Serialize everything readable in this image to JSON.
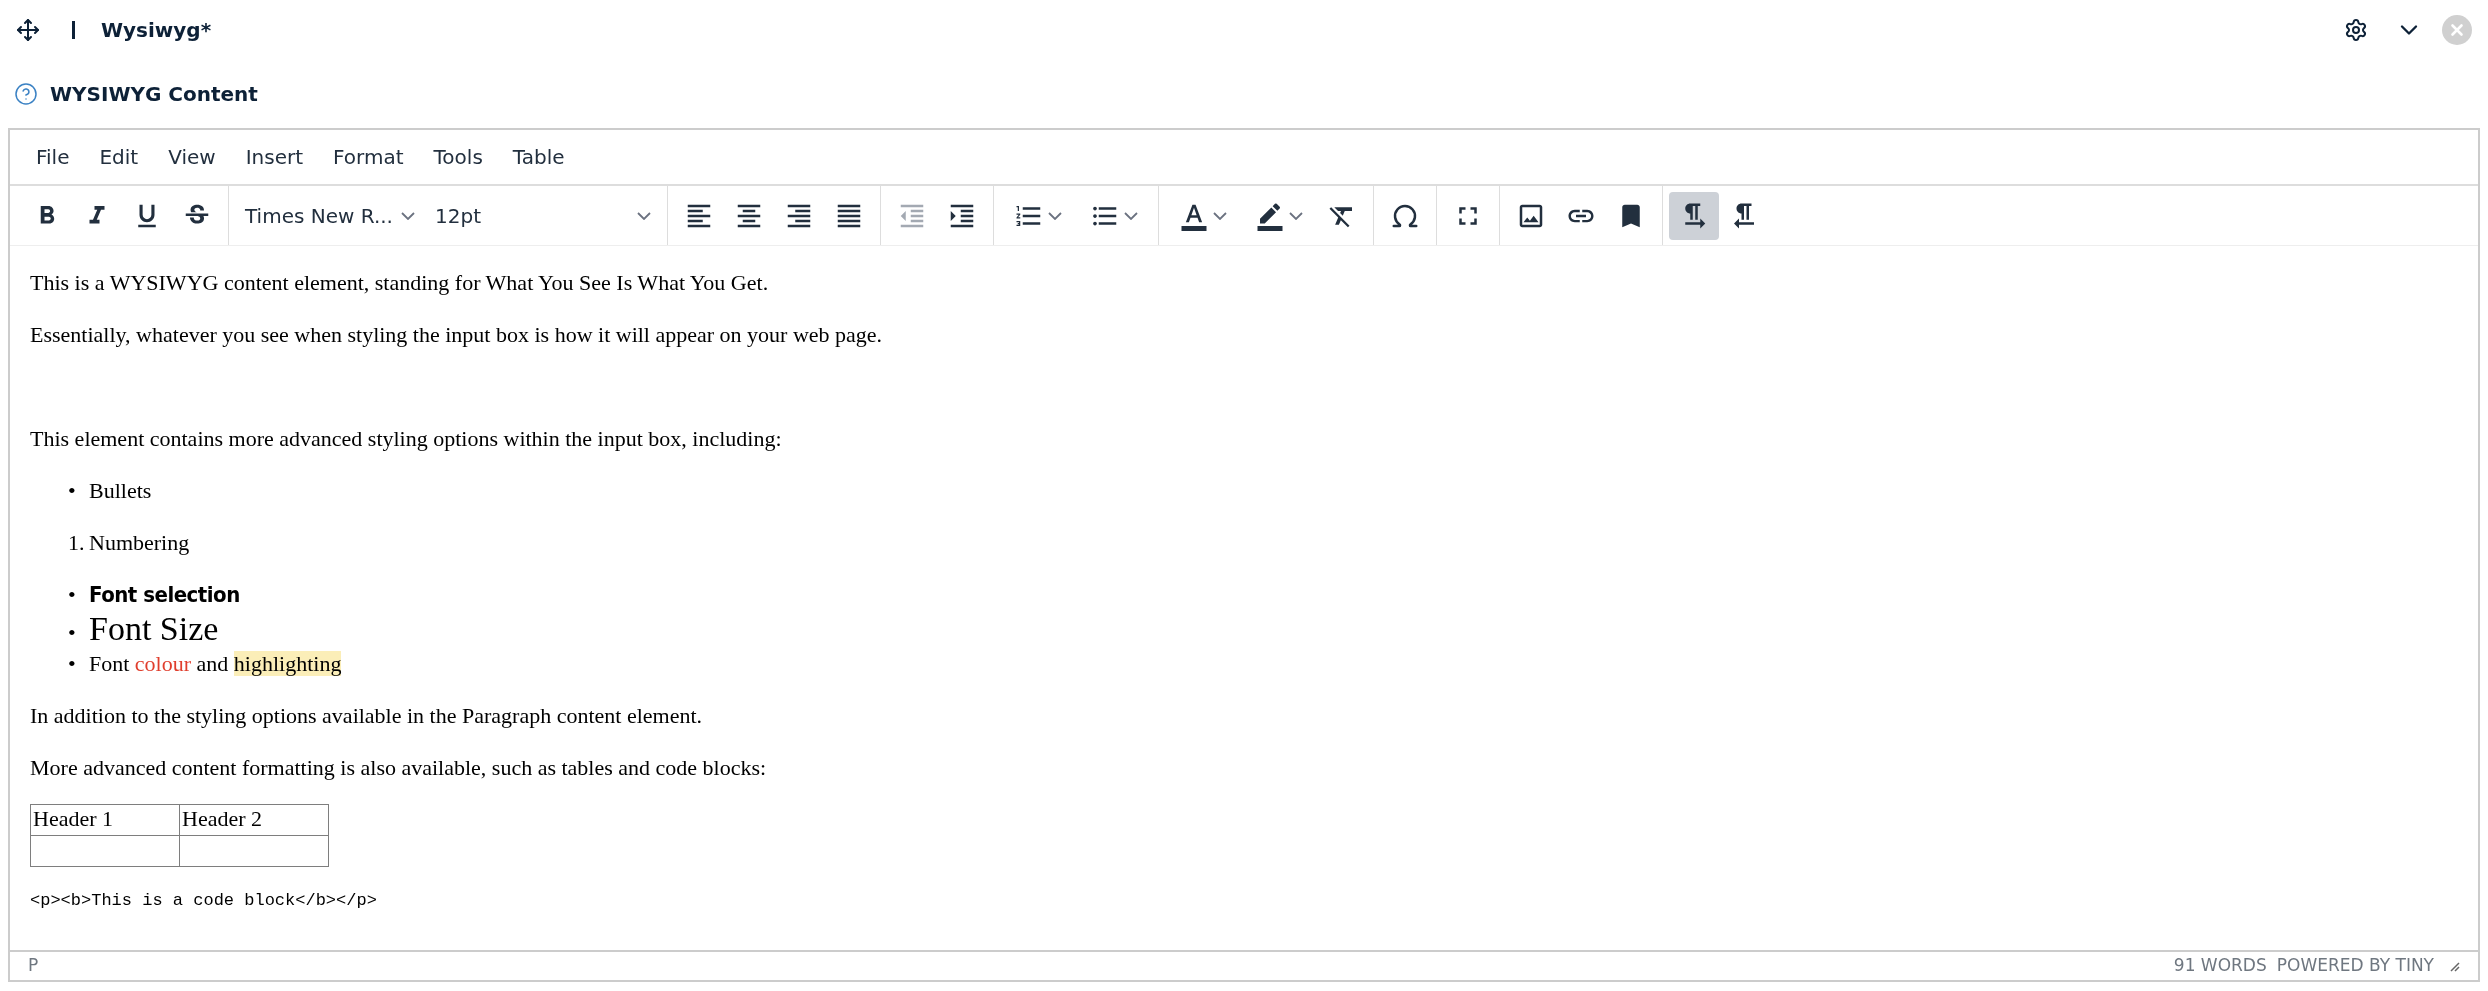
{
  "header": {
    "title": "Wysiwyg*"
  },
  "section": {
    "title": "WYSIWYG Content"
  },
  "menu": [
    "File",
    "Edit",
    "View",
    "Insert",
    "Format",
    "Tools",
    "Table"
  ],
  "toolbar": [
    [
      {
        "kind": "button",
        "selected": false,
        "disabled": false
      },
      {
        "kind": "button",
        "selected": false,
        "disabled": false
      },
      {
        "kind": "button",
        "selected": false,
        "disabled": false
      },
      {
        "kind": "button",
        "selected": false,
        "disabled": false
      }
    ],
    [
      {
        "kind": "select",
        "value": "Times New R..."
      },
      {
        "kind": "select",
        "value": "12pt"
      }
    ],
    [
      {
        "kind": "button",
        "selected": false,
        "disabled": false
      },
      {
        "kind": "button",
        "selected": false,
        "disabled": false
      },
      {
        "kind": "button",
        "selected": false,
        "disabled": false
      },
      {
        "kind": "button",
        "selected": false,
        "disabled": false
      }
    ],
    [
      {
        "kind": "button",
        "selected": false,
        "disabled": true
      },
      {
        "kind": "button",
        "selected": false,
        "disabled": false
      }
    ],
    [
      {
        "kind": "split",
        "selected": false,
        "disabled": false
      },
      {
        "kind": "split",
        "selected": false,
        "disabled": false
      }
    ],
    [
      {
        "kind": "split",
        "selected": false,
        "disabled": false
      },
      {
        "kind": "split",
        "selected": false,
        "disabled": false
      },
      {
        "kind": "button",
        "selected": false,
        "disabled": false
      }
    ],
    [
      {
        "kind": "button",
        "selected": false,
        "disabled": false
      }
    ],
    [
      {
        "kind": "button",
        "selected": false,
        "disabled": false
      }
    ],
    [
      {
        "kind": "button",
        "selected": false,
        "disabled": false
      },
      {
        "kind": "button",
        "selected": false,
        "disabled": false
      },
      {
        "kind": "button",
        "selected": false,
        "disabled": false
      }
    ],
    [
      {
        "kind": "button",
        "selected": true,
        "disabled": false
      },
      {
        "kind": "button",
        "selected": false,
        "disabled": false
      }
    ]
  ],
  "content": [
    {
      "kind": "paragraph",
      "segments": [
        {
          "text": "This is a WYSIWYG content element, standing for What You See Is What You Get."
        }
      ]
    },
    {
      "kind": "paragraph",
      "segments": [
        {
          "text": "Essentially, whatever you see when styling the input box is how it will appear on your web page."
        }
      ]
    },
    {
      "kind": "empty"
    },
    {
      "kind": "paragraph",
      "segments": [
        {
          "text": "This element contains more advanced styling options within the input box, including:"
        }
      ]
    },
    {
      "kind": "list",
      "items": [
        {
          "marker": "•",
          "kind": "normal",
          "segments": [
            {
              "text": "Bullets"
            }
          ]
        }
      ]
    },
    {
      "kind": "list",
      "items": [
        {
          "marker": "1.",
          "kind": "normal",
          "segments": [
            {
              "text": "Numbering"
            }
          ]
        }
      ]
    },
    {
      "kind": "list",
      "items": [
        {
          "marker": "•",
          "kind": "display",
          "segments": [
            {
              "text": "Font selection"
            }
          ]
        },
        {
          "marker": "•",
          "kind": "large",
          "segments": [
            {
              "text": "Font Size"
            }
          ]
        },
        {
          "marker": "•",
          "kind": "normal",
          "segments": [
            {
              "text": "Font "
            },
            {
              "text": "colour",
              "color": "#e03e2d"
            },
            {
              "text": " and "
            },
            {
              "text": "highlighting",
              "kind": "highlighted"
            }
          ]
        }
      ]
    },
    {
      "kind": "paragraph",
      "segments": [
        {
          "text": "In addition to the styling options available in the Paragraph content element."
        }
      ]
    },
    {
      "kind": "paragraph",
      "segments": [
        {
          "text": "More advanced content formatting is also available, such as tables and code blocks:"
        }
      ]
    },
    {
      "kind": "table",
      "rows": [
        [
          "Header 1",
          "Header 2"
        ],
        [
          null,
          null
        ]
      ]
    },
    {
      "kind": "code",
      "text": "<p><b>This is a code block</b></p>"
    }
  ],
  "status": {
    "path": "P",
    "words": "91 WORDS",
    "branding": "POWERED BY TINY"
  }
}
